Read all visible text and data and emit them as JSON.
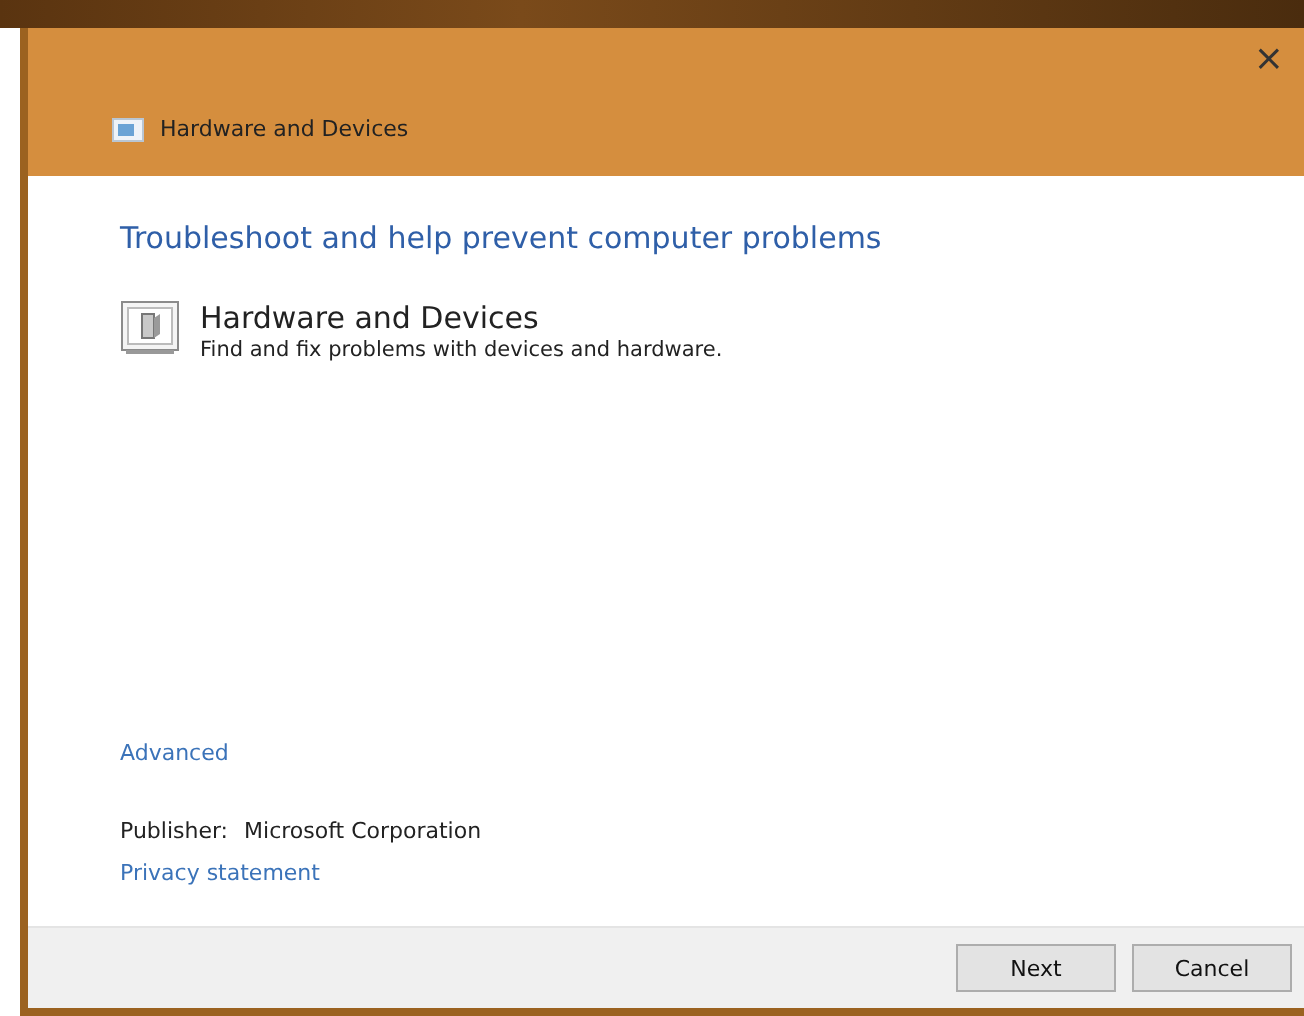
{
  "window": {
    "title": "Hardware and Devices",
    "close": "×"
  },
  "heading": "Troubleshoot and help prevent computer problems",
  "troubleshooter": {
    "title": "Hardware and Devices",
    "description": "Find and fix problems with devices and hardware."
  },
  "advanced_link": "Advanced",
  "publisher": {
    "label": "Publisher:",
    "value": "Microsoft Corporation"
  },
  "privacy_link": "Privacy statement",
  "buttons": [
    {
      "label": "Next"
    },
    {
      "label": "Cancel"
    }
  ]
}
